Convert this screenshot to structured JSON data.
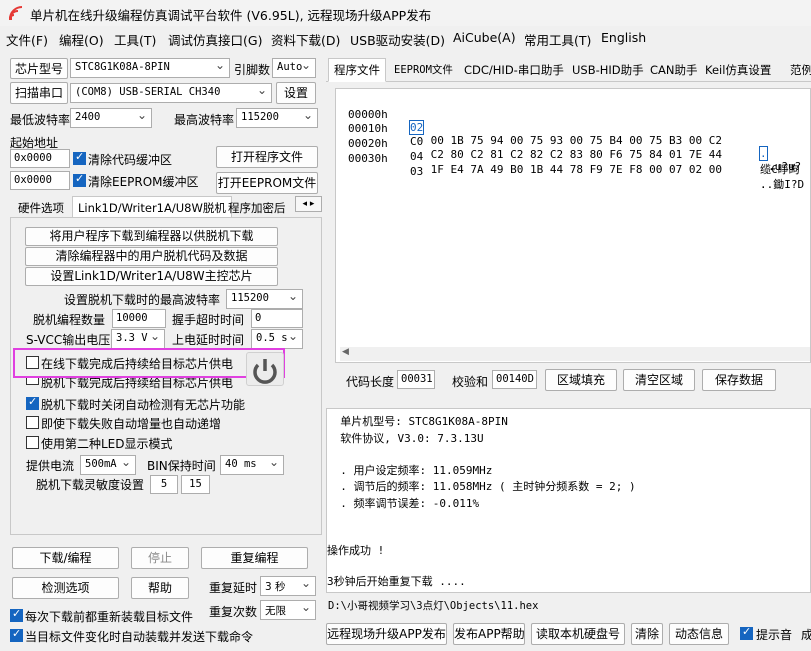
{
  "window": {
    "title": "单片机在线升级编程仿真调试平台软件 (V6.95L), 远程现场升级APP发布"
  },
  "menu": [
    "文件(F)",
    "编程(O)",
    "工具(T)",
    "调试仿真接口(G)",
    "资料下载(D)",
    "USB驱动安装(D)",
    "AiCube(A)",
    "常用工具(T)",
    "English"
  ],
  "left": {
    "chip_label": "芯片型号",
    "chip_value": "STC8G1K08A-8PIN",
    "pin_label": "引脚数",
    "pin_value": "Auto",
    "scan_button": "扫描串口",
    "port_value": "(COM8) USB-SERIAL CH340",
    "settings_button": "设置",
    "min_baud_label": "最低波特率",
    "min_baud_value": "2400",
    "max_baud_label": "最高波特率",
    "max_baud_value": "115200",
    "start_addr_label": "起始地址",
    "addr1": "0x0000",
    "clear_code_label": "清除代码缓冲区",
    "open_program_button": "打开程序文件",
    "addr2": "0x0000",
    "clear_eeprom_label": "清除EEPROM缓冲区",
    "open_eeprom_button": "打开EEPROM文件"
  },
  "tabs": [
    "硬件选项",
    "Link1D/Writer1A/U8W脱机",
    "程序加密后"
  ],
  "offline": {
    "btn1": "将用户程序下载到编程器以供脱机下载",
    "btn2": "清除编程器中的用户脱机代码及数据",
    "btn3": "设置Link1D/Writer1A/U8W主控芯片",
    "max_baud_label": "设置脱机下载时的最高波特率",
    "max_baud_value": "115200",
    "count_label": "脱机编程数量",
    "count_value": "10000",
    "handshake_label": "握手超时时间",
    "handshake_value": "0",
    "vcc_label": "S-VCC输出电压",
    "vcc_value": "3.3 V",
    "delay_label": "上电延时时间",
    "delay_value": "0.5 s",
    "cb1": "在线下载完成后持续给目标芯片供电",
    "cb2": "脱机下载完成后持续给目标芯片供电",
    "cb3": "脱机下载时关闭自动检测有无芯片功能",
    "cb4": "即使下载失败自动增量也自动递增",
    "cb5": "使用第二种LED显示模式",
    "current_label": "提供电流",
    "current_value": "500mA",
    "bin_label": "BIN保持时间",
    "bin_value": "40 ms",
    "sens_label": "脱机下载灵敏度设置",
    "sens1": "5",
    "sens2": "15"
  },
  "bottom_left": {
    "download_button": "下载/编程",
    "stop_button": "停止",
    "reprogram_button": "重复编程",
    "detect_button": "检测选项",
    "help_button": "帮助",
    "repeat_delay_label": "重复延时",
    "repeat_delay_value": "3 秒",
    "repeat_count_label": "重复次数",
    "repeat_count_value": "无限",
    "reload_label": "每次下载前都重新装载目标文件",
    "auto_label": "当目标文件变化时自动装载并发送下载命令"
  },
  "right_tabs": [
    "程序文件",
    "EEPROM文件",
    "CDC/HID-串口助手",
    "USB-HID助手",
    "CAN助手",
    "Keil仿真设置",
    "范例"
  ],
  "hex": [
    {
      "addr": "00000h",
      "first": "02",
      "bytes": " 00 1B 75 94 00 75 93 00 75 B4 00 75 B3 00 C2",
      "ascii_first": ".",
      "ascii": ".u?u?"
    },
    {
      "addr": "00010h",
      "first": "C0",
      "bytes": " C2 80 C2 81 C2 82 C2 83 80 F6 75 84 01 7E 44",
      "ascii_first": "",
      "ascii": "缆€睜眗"
    },
    {
      "addr": "00020h",
      "first": "04",
      "bytes": " 1F E4 7A 49 B0 1B 44 78 F9 7E F8 00 07 02 00",
      "ascii_first": "",
      "ascii": "..鋤I?D"
    },
    {
      "addr": "00030h",
      "first": "03",
      "bytes": "",
      "ascii_first": "",
      "ascii": "."
    }
  ],
  "code_bar": {
    "length_label": "代码长度",
    "length_value": "00031",
    "checksum_label": "校验和",
    "checksum_value": "00140D",
    "fill_button": "区域填充",
    "clear_button": "清空区域",
    "save_button": "保存数据"
  },
  "log": {
    "lines": [
      "  单片机型号: STC8G1K08A-8PIN",
      "  软件协议, V3.0: 7.3.13U",
      "",
      "  . 用户设定频率: 11.059MHz",
      "  . 调节后的频率: 11.058MHz ( 主时钟分频系数 = 2; )",
      "  . 频率调节误差: -0.011%",
      "",
      "",
      "",
      "操作成功 !",
      "",
      "3秒钟后开始重复下载 ...."
    ],
    "path": "D:\\小哥视频学习\\3点灯\\Objects\\11.hex"
  },
  "bottom_right": {
    "publish_button": "远程现场升级APP发布",
    "publish_help_button": "发布APP帮助",
    "read_disk_button": "读取本机硬盘号",
    "clear_button": "清除",
    "dynamic_button": "动态信息",
    "tone_label": "提示音",
    "tail": "成"
  },
  "colors": {
    "highlight": "#e040e0",
    "accent": "#1565c0",
    "logo": "#e53935"
  }
}
